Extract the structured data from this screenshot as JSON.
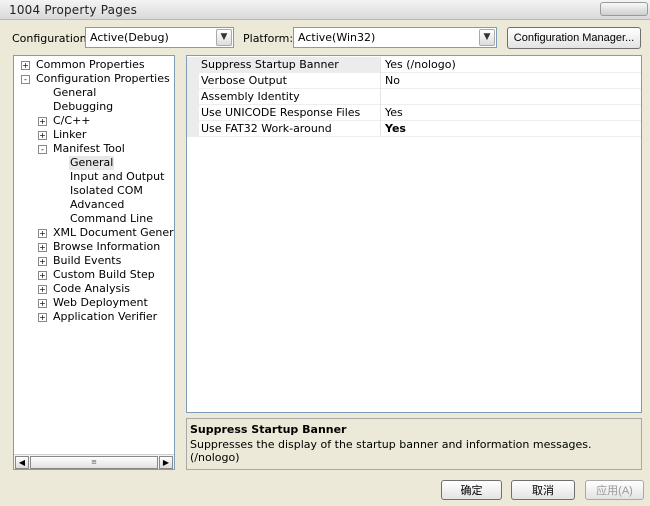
{
  "window": {
    "title": "1004 Property Pages"
  },
  "toolbar": {
    "configuration_label": "Configuration:",
    "configuration_value": "Active(Debug)",
    "platform_label": "Platform:",
    "platform_value": "Active(Win32)",
    "config_manager_label": "Configuration Manager..."
  },
  "tree": {
    "items": [
      {
        "label": "Common Properties",
        "expander": "+"
      },
      {
        "label": "Configuration Properties",
        "expander": "-"
      },
      {
        "label": "General",
        "expander": ""
      },
      {
        "label": "Debugging",
        "expander": ""
      },
      {
        "label": "C/C++",
        "expander": "+"
      },
      {
        "label": "Linker",
        "expander": "+"
      },
      {
        "label": "Manifest Tool",
        "expander": "-"
      },
      {
        "label": "General",
        "expander": ""
      },
      {
        "label": "Input and Output",
        "expander": ""
      },
      {
        "label": "Isolated COM",
        "expander": ""
      },
      {
        "label": "Advanced",
        "expander": ""
      },
      {
        "label": "Command Line",
        "expander": ""
      },
      {
        "label": "XML Document Generator",
        "expander": "+"
      },
      {
        "label": "Browse Information",
        "expander": "+"
      },
      {
        "label": "Build Events",
        "expander": "+"
      },
      {
        "label": "Custom Build Step",
        "expander": "+"
      },
      {
        "label": "Code Analysis",
        "expander": "+"
      },
      {
        "label": "Web Deployment",
        "expander": "+"
      },
      {
        "label": "Application Verifier",
        "expander": "+"
      }
    ],
    "scroll_thumb_glyph": "≡"
  },
  "properties": [
    {
      "name": "Suppress Startup Banner",
      "value": "Yes (/nologo)"
    },
    {
      "name": "Verbose Output",
      "value": "No"
    },
    {
      "name": "Assembly Identity",
      "value": ""
    },
    {
      "name": "Use UNICODE Response Files",
      "value": "Yes"
    },
    {
      "name": "Use FAT32 Work-around",
      "value": "Yes"
    }
  ],
  "description": {
    "title": "Suppress Startup Banner",
    "text": "Suppresses the display of the startup banner and information messages.      (/nologo)"
  },
  "buttons": {
    "ok": "确定",
    "cancel": "取消",
    "apply": "应用(A)"
  },
  "icons": {
    "dropdown": "chevron-down-icon",
    "scroll_left": "arrow-left-icon",
    "scroll_right": "arrow-right-icon"
  }
}
